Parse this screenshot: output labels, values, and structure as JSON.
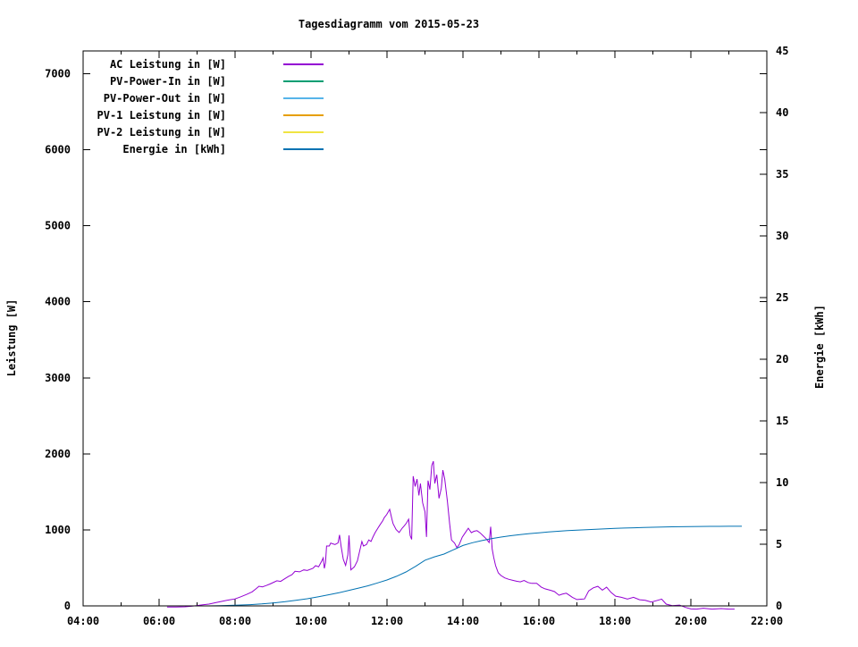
{
  "chart_data": {
    "type": "line",
    "title": "Tagesdiagramm vom 2015-05-23",
    "grid": false,
    "legend_position": "top-left-inside",
    "x_axis": {
      "range_hours": [
        4,
        22
      ],
      "major_ticks": [
        {
          "hour": 4,
          "label": "04:00"
        },
        {
          "hour": 6,
          "label": "06:00"
        },
        {
          "hour": 8,
          "label": "08:00"
        },
        {
          "hour": 10,
          "label": "10:00"
        },
        {
          "hour": 12,
          "label": "12:00"
        },
        {
          "hour": 14,
          "label": "14:00"
        },
        {
          "hour": 16,
          "label": "16:00"
        },
        {
          "hour": 18,
          "label": "18:00"
        },
        {
          "hour": 20,
          "label": "20:00"
        },
        {
          "hour": 22,
          "label": "22:00"
        }
      ],
      "minor_tick_hours": [
        5,
        7,
        9,
        11,
        13,
        15,
        17,
        19,
        21
      ]
    },
    "y_axis": {
      "label": "Leistung [W]",
      "range": [
        0,
        7300
      ],
      "tick_values": [
        0,
        1000,
        2000,
        3000,
        4000,
        5000,
        6000,
        7000
      ]
    },
    "y2_axis": {
      "label": "Energie [kWh]",
      "range": [
        0,
        45
      ],
      "tick_values": [
        0,
        5,
        10,
        15,
        20,
        25,
        30,
        35,
        40,
        45
      ]
    },
    "series": [
      {
        "name": "AC Leistung in [W]",
        "color": "#9400D3",
        "axis": "y1",
        "points": [
          [
            6.21,
            -15
          ],
          [
            6.45,
            -15
          ],
          [
            6.68,
            -12
          ],
          [
            6.85,
            -5
          ],
          [
            7.0,
            5
          ],
          [
            7.15,
            15
          ],
          [
            7.31,
            24
          ],
          [
            7.5,
            45
          ],
          [
            7.7,
            65
          ],
          [
            7.85,
            80
          ],
          [
            8.0,
            92
          ],
          [
            8.15,
            120
          ],
          [
            8.3,
            150
          ],
          [
            8.45,
            185
          ],
          [
            8.55,
            225
          ],
          [
            8.63,
            259
          ],
          [
            8.72,
            250
          ],
          [
            8.82,
            268
          ],
          [
            8.92,
            288
          ],
          [
            9.02,
            312
          ],
          [
            9.1,
            330
          ],
          [
            9.2,
            322
          ],
          [
            9.3,
            355
          ],
          [
            9.4,
            385
          ],
          [
            9.5,
            412
          ],
          [
            9.58,
            455
          ],
          [
            9.7,
            448
          ],
          [
            9.81,
            474
          ],
          [
            9.9,
            465
          ],
          [
            10.05,
            494
          ],
          [
            10.12,
            529
          ],
          [
            10.2,
            515
          ],
          [
            10.28,
            588
          ],
          [
            10.32,
            631
          ],
          [
            10.35,
            494
          ],
          [
            10.38,
            568
          ],
          [
            10.41,
            788
          ],
          [
            10.48,
            788
          ],
          [
            10.52,
            827
          ],
          [
            10.56,
            818
          ],
          [
            10.63,
            808
          ],
          [
            10.71,
            827
          ],
          [
            10.75,
            933
          ],
          [
            10.79,
            788
          ],
          [
            10.85,
            612
          ],
          [
            10.91,
            533
          ],
          [
            10.97,
            670
          ],
          [
            11.0,
            926
          ],
          [
            11.05,
            474
          ],
          [
            11.14,
            514
          ],
          [
            11.22,
            592
          ],
          [
            11.34,
            847
          ],
          [
            11.38,
            788
          ],
          [
            11.46,
            808
          ],
          [
            11.52,
            867
          ],
          [
            11.58,
            847
          ],
          [
            11.63,
            906
          ],
          [
            11.69,
            965
          ],
          [
            11.76,
            1023
          ],
          [
            11.81,
            1062
          ],
          [
            11.89,
            1121
          ],
          [
            11.93,
            1161
          ],
          [
            11.99,
            1200
          ],
          [
            12.07,
            1270
          ],
          [
            12.13,
            1141
          ],
          [
            12.16,
            1082
          ],
          [
            12.24,
            1004
          ],
          [
            12.32,
            965
          ],
          [
            12.4,
            1023
          ],
          [
            12.45,
            1050
          ],
          [
            12.51,
            1088
          ],
          [
            12.57,
            1140
          ],
          [
            12.61,
            925
          ],
          [
            12.65,
            875
          ],
          [
            12.69,
            1706
          ],
          [
            12.74,
            1570
          ],
          [
            12.79,
            1668
          ],
          [
            12.84,
            1452
          ],
          [
            12.88,
            1610
          ],
          [
            12.94,
            1355
          ],
          [
            13.0,
            1238
          ],
          [
            13.04,
            908
          ],
          [
            13.08,
            1648
          ],
          [
            13.13,
            1530
          ],
          [
            13.18,
            1845
          ],
          [
            13.22,
            1903
          ],
          [
            13.26,
            1610
          ],
          [
            13.31,
            1726
          ],
          [
            13.37,
            1414
          ],
          [
            13.43,
            1550
          ],
          [
            13.47,
            1786
          ],
          [
            13.52,
            1668
          ],
          [
            13.59,
            1374
          ],
          [
            13.65,
            1080
          ],
          [
            13.7,
            866
          ],
          [
            13.78,
            826
          ],
          [
            13.84,
            766
          ],
          [
            13.9,
            806
          ],
          [
            13.98,
            904
          ],
          [
            14.06,
            962
          ],
          [
            14.14,
            1022
          ],
          [
            14.22,
            963
          ],
          [
            14.29,
            982
          ],
          [
            14.37,
            990
          ],
          [
            14.45,
            962
          ],
          [
            14.53,
            923
          ],
          [
            14.61,
            884
          ],
          [
            14.69,
            833
          ],
          [
            14.73,
            1042
          ],
          [
            14.77,
            748
          ],
          [
            14.81,
            638
          ],
          [
            14.86,
            530
          ],
          [
            14.93,
            435
          ],
          [
            15.0,
            400
          ],
          [
            15.1,
            368
          ],
          [
            15.2,
            350
          ],
          [
            15.31,
            336
          ],
          [
            15.41,
            324
          ],
          [
            15.51,
            316
          ],
          [
            15.61,
            335
          ],
          [
            15.71,
            308
          ],
          [
            15.81,
            296
          ],
          [
            15.94,
            297
          ],
          [
            16.06,
            248
          ],
          [
            16.16,
            224
          ],
          [
            16.31,
            204
          ],
          [
            16.41,
            188
          ],
          [
            16.53,
            140
          ],
          [
            16.61,
            154
          ],
          [
            16.72,
            167
          ],
          [
            16.81,
            138
          ],
          [
            16.88,
            113
          ],
          [
            17.0,
            84
          ],
          [
            17.11,
            88
          ],
          [
            17.2,
            92
          ],
          [
            17.31,
            198
          ],
          [
            17.43,
            238
          ],
          [
            17.55,
            258
          ],
          [
            17.67,
            207
          ],
          [
            17.78,
            246
          ],
          [
            17.9,
            178
          ],
          [
            18.02,
            128
          ],
          [
            18.17,
            113
          ],
          [
            18.33,
            89
          ],
          [
            18.49,
            113
          ],
          [
            18.65,
            81
          ],
          [
            18.8,
            73
          ],
          [
            18.96,
            50
          ],
          [
            19.12,
            73
          ],
          [
            19.23,
            89
          ],
          [
            19.35,
            23
          ],
          [
            19.51,
            4
          ],
          [
            19.7,
            11
          ],
          [
            19.86,
            -20
          ],
          [
            20.0,
            -40
          ],
          [
            20.15,
            -42
          ],
          [
            20.33,
            -30
          ],
          [
            20.56,
            -42
          ],
          [
            20.8,
            -35
          ],
          [
            21.0,
            -42
          ],
          [
            21.15,
            -42
          ]
        ]
      },
      {
        "name": "PV-Power-In in [W]",
        "color": "#009E73",
        "axis": "y1",
        "points": []
      },
      {
        "name": "PV-Power-Out in [W]",
        "color": "#56B4E9",
        "axis": "y1",
        "points": []
      },
      {
        "name": "PV-1 Leistung in [W]",
        "color": "#E69F00",
        "axis": "y1",
        "points": []
      },
      {
        "name": "PV-2 Leistung in [W]",
        "color": "#F0E442",
        "axis": "y1",
        "points": []
      },
      {
        "name": "Energie in [kWh]",
        "color": "#0072B2",
        "axis": "y2",
        "points": [
          [
            7.3,
            0
          ],
          [
            7.6,
            0.02
          ],
          [
            8.0,
            0.05
          ],
          [
            8.4,
            0.1
          ],
          [
            8.7,
            0.16
          ],
          [
            9.0,
            0.24
          ],
          [
            9.3,
            0.33
          ],
          [
            9.6,
            0.45
          ],
          [
            9.9,
            0.58
          ],
          [
            10.2,
            0.74
          ],
          [
            10.5,
            0.92
          ],
          [
            10.75,
            1.08
          ],
          [
            11.0,
            1.26
          ],
          [
            11.25,
            1.44
          ],
          [
            11.5,
            1.63
          ],
          [
            11.75,
            1.86
          ],
          [
            12.0,
            2.1
          ],
          [
            12.25,
            2.4
          ],
          [
            12.5,
            2.75
          ],
          [
            12.75,
            3.2
          ],
          [
            13.0,
            3.7
          ],
          [
            13.25,
            3.98
          ],
          [
            13.5,
            4.2
          ],
          [
            13.75,
            4.55
          ],
          [
            14.0,
            4.9
          ],
          [
            14.25,
            5.12
          ],
          [
            14.5,
            5.3
          ],
          [
            14.75,
            5.46
          ],
          [
            15.0,
            5.58
          ],
          [
            15.25,
            5.69
          ],
          [
            15.5,
            5.78
          ],
          [
            15.75,
            5.86
          ],
          [
            16.0,
            5.93
          ],
          [
            16.25,
            5.99
          ],
          [
            16.5,
            6.05
          ],
          [
            16.75,
            6.1
          ],
          [
            17.0,
            6.14
          ],
          [
            17.25,
            6.18
          ],
          [
            17.5,
            6.22
          ],
          [
            17.75,
            6.25
          ],
          [
            18.0,
            6.28
          ],
          [
            18.25,
            6.31
          ],
          [
            18.5,
            6.33
          ],
          [
            18.75,
            6.36
          ],
          [
            19.0,
            6.38
          ],
          [
            19.25,
            6.39
          ],
          [
            19.5,
            6.41
          ],
          [
            19.75,
            6.42
          ],
          [
            20.0,
            6.43
          ],
          [
            20.25,
            6.44
          ],
          [
            20.5,
            6.45
          ],
          [
            20.75,
            6.45
          ],
          [
            21.0,
            6.46
          ],
          [
            21.34,
            6.46
          ]
        ]
      }
    ],
    "colors": {
      "background": "#FFFFFF",
      "foreground": "#000000"
    }
  }
}
